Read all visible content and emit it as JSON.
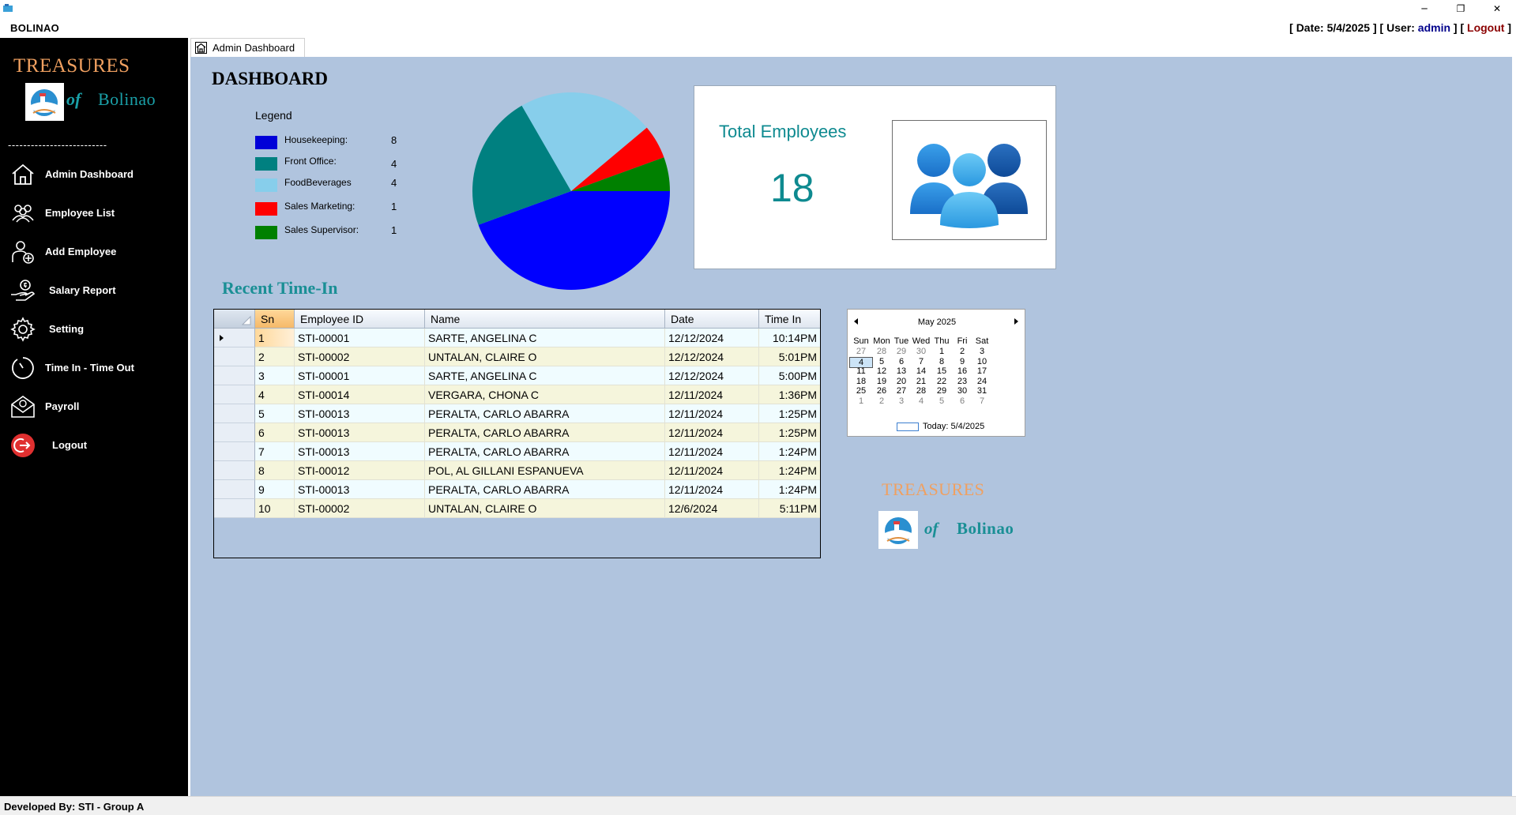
{
  "window": {
    "title": "BOLINAO",
    "minimize": "─",
    "maximize": "❐",
    "close": "✕"
  },
  "status": {
    "date_label": "Date:",
    "date_value": "5/4/2025",
    "user_label": "User:",
    "user_value": "admin",
    "logout": "Logout"
  },
  "sidebar": {
    "brand_top": "TREASURES",
    "brand_of": "of",
    "brand_name": "Bolinao",
    "divider": "--------------------------",
    "items": [
      {
        "label": "Admin Dashboard",
        "icon": "home-icon"
      },
      {
        "label": "Employee List",
        "icon": "people-icon"
      },
      {
        "label": "Add Employee",
        "icon": "add-user-icon"
      },
      {
        "label": "Salary Report",
        "icon": "salary-icon"
      },
      {
        "label": "Setting",
        "icon": "gear-icon"
      },
      {
        "label": "Time In - Time Out",
        "icon": "clock-icon"
      },
      {
        "label": "Payroll",
        "icon": "payroll-icon"
      },
      {
        "label": "Logout",
        "icon": "logout-icon"
      }
    ]
  },
  "tab": {
    "label": "Admin Dashboard"
  },
  "dashboard": {
    "title": "DASHBOARD",
    "legend_title": "Legend",
    "total_employees_label": "Total Employees",
    "total_employees_value": "18",
    "recent_title": "Recent Time-In"
  },
  "chart_data": {
    "type": "pie",
    "series": [
      {
        "name": "Housekeeping:",
        "value": 8,
        "color": "#0000ff"
      },
      {
        "name": "Front Office:",
        "value": 4,
        "color": "#008080"
      },
      {
        "name": "FoodBeverages",
        "value": 4,
        "color": "#87ceeb"
      },
      {
        "name": "Sales Marketing:",
        "value": 1,
        "color": "#ff0000"
      },
      {
        "name": "Sales Supervisor:",
        "value": 1,
        "color": "#008000"
      }
    ]
  },
  "grid": {
    "columns": [
      "Sn",
      "Employee ID",
      "Name",
      "Date",
      "Time In"
    ],
    "rows": [
      [
        "1",
        "STI-00001",
        "SARTE, ANGELINA C",
        "12/12/2024",
        "10:14PM"
      ],
      [
        "2",
        "STI-00002",
        "UNTALAN, CLAIRE O",
        "12/12/2024",
        "5:01PM"
      ],
      [
        "3",
        "STI-00001",
        "SARTE, ANGELINA C",
        "12/12/2024",
        "5:00PM"
      ],
      [
        "4",
        "STI-00014",
        "VERGARA, CHONA C",
        "12/11/2024",
        "1:36PM"
      ],
      [
        "5",
        "STI-00013",
        "PERALTA, CARLO ABARRA",
        "12/11/2024",
        "1:25PM"
      ],
      [
        "6",
        "STI-00013",
        "PERALTA, CARLO ABARRA",
        "12/11/2024",
        "1:25PM"
      ],
      [
        "7",
        "STI-00013",
        "PERALTA, CARLO ABARRA",
        "12/11/2024",
        "1:24PM"
      ],
      [
        "8",
        "STI-00012",
        "POL, AL GILLANI ESPANUEVA",
        "12/11/2024",
        "1:24PM"
      ],
      [
        "9",
        "STI-00013",
        "PERALTA, CARLO ABARRA",
        "12/11/2024",
        "1:24PM"
      ],
      [
        "10",
        "STI-00002",
        "UNTALAN, CLAIRE O",
        "12/6/2024",
        "5:11PM"
      ]
    ]
  },
  "calendar": {
    "month_title": "May 2025",
    "days_of_week": [
      "Sun",
      "Mon",
      "Tue",
      "Wed",
      "Thu",
      "Fri",
      "Sat"
    ],
    "weeks": [
      [
        "27",
        "28",
        "29",
        "30",
        "1",
        "2",
        "3"
      ],
      [
        "4",
        "5",
        "6",
        "7",
        "8",
        "9",
        "10"
      ],
      [
        "11",
        "12",
        "13",
        "14",
        "15",
        "16",
        "17"
      ],
      [
        "18",
        "19",
        "20",
        "21",
        "22",
        "23",
        "24"
      ],
      [
        "25",
        "26",
        "27",
        "28",
        "29",
        "30",
        "31"
      ],
      [
        "1",
        "2",
        "3",
        "4",
        "5",
        "6",
        "7"
      ]
    ],
    "selected_day": "4",
    "today_label": "Today: 5/4/2025"
  },
  "bottom_brand": {
    "top": "TREASURES",
    "of": "of",
    "name": "Bolinao"
  },
  "footer": {
    "text": "Developed By: STI - Group A"
  }
}
